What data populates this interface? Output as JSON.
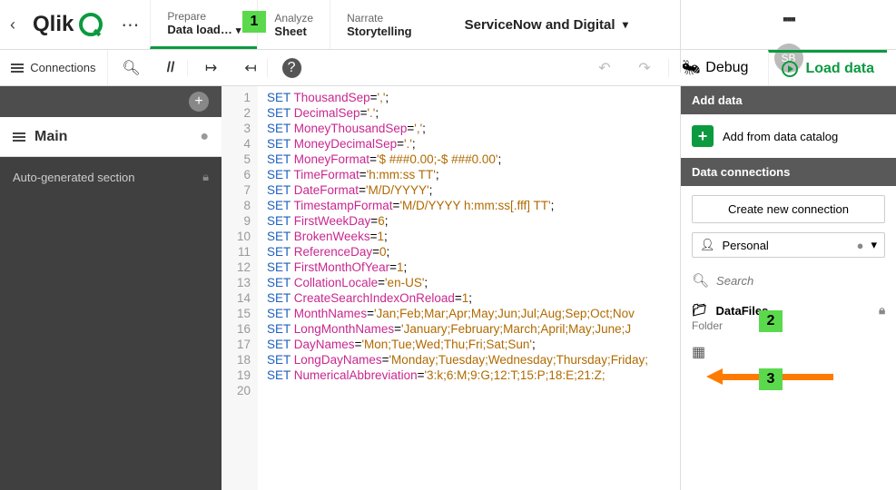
{
  "header": {
    "logo_text": "Qlik",
    "nav": {
      "prepare_small": "Prepare",
      "prepare_label": "Data load…",
      "analyze_small": "Analyze",
      "analyze_label": "Sheet",
      "narrate_small": "Narrate",
      "narrate_label": "Storytelling"
    },
    "app_name": "ServiceNow and Digital",
    "avatar": "SB"
  },
  "toolbar": {
    "connections": "Connections",
    "debug": "Debug",
    "load": "Load data"
  },
  "side": {
    "main": "Main",
    "section": "Auto-generated section"
  },
  "code_lines": {
    "1": {
      "v": "ThousandSep",
      "s": "','"
    },
    "2": {
      "v": "DecimalSep",
      "s": "'.'"
    },
    "3": {
      "v": "MoneyThousandSep",
      "s": "','"
    },
    "4": {
      "v": "MoneyDecimalSep",
      "s": "'.'"
    },
    "5": {
      "v": "MoneyFormat",
      "s": "'$ ###0.00;-$ ###0.00'"
    },
    "6": {
      "v": "TimeFormat",
      "s": "'h:mm:ss TT'"
    },
    "7": {
      "v": "DateFormat",
      "s": "'M/D/YYYY'"
    },
    "8": {
      "v": "TimestampFormat",
      "s": "'M/D/YYYY h:mm:ss[.fff] TT'"
    },
    "9": {
      "v": "FirstWeekDay",
      "n": "6"
    },
    "10": {
      "v": "BrokenWeeks",
      "n": "1"
    },
    "11": {
      "v": "ReferenceDay",
      "n": "0"
    },
    "12": {
      "v": "FirstMonthOfYear",
      "n": "1"
    },
    "13": {
      "v": "CollationLocale",
      "s": "'en-US'"
    },
    "14": {
      "v": "CreateSearchIndexOnReload",
      "n": "1"
    },
    "15": {
      "v": "MonthNames",
      "s": "'Jan;Feb;Mar;Apr;May;Jun;Jul;Aug;Sep;Oct;Nov"
    },
    "16": {
      "v": "LongMonthNames",
      "s": "'January;February;March;April;May;June;J"
    },
    "17": {
      "v": "DayNames",
      "s": "'Mon;Tue;Wed;Thu;Fri;Sat;Sun'"
    },
    "18": {
      "v": "LongDayNames",
      "s": "'Monday;Tuesday;Wednesday;Thursday;Friday;"
    },
    "19": {
      "v": "NumericalAbbreviation",
      "s": "'3:k;6:M;9:G;12:T;15:P;18:E;21:Z;"
    }
  },
  "right": {
    "add_data": "Add data",
    "add_catalog": "Add from data catalog",
    "data_connections": "Data connections",
    "create": "Create new connection",
    "personal": "Personal",
    "search_placeholder": "Search",
    "datafiles": "DataFiles",
    "folder": "Folder"
  },
  "annotations": {
    "m1": "1",
    "m2": "2",
    "m3": "3"
  }
}
